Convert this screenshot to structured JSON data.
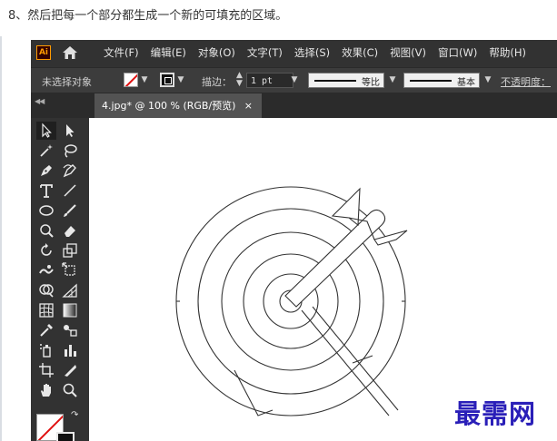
{
  "instruction": "8、然后把每一个部分都生成一个新的可填充的区域。",
  "app": {
    "logo_text": "Ai",
    "menu": [
      "文件(F)",
      "编辑(E)",
      "对象(O)",
      "文字(T)",
      "选择(S)",
      "效果(C)",
      "视图(V)",
      "窗口(W)",
      "帮助(H)"
    ]
  },
  "controlbar": {
    "selection_state": "未选择对象",
    "stroke_label": "描边：",
    "stroke_value": "1 pt",
    "profile_1": "等比",
    "profile_2": "基本",
    "opacity_label": "不透明度："
  },
  "document_tab": {
    "label": "4.jpg* @ 100 % (RGB/预览)",
    "close": "×"
  },
  "watermark": "最需网",
  "colors": {
    "app_bg": "#323232",
    "accent_logo": "#ff9a00",
    "watermark": "#2a1fb8"
  },
  "icons": [
    "home-icon",
    "selection-tool-icon",
    "direct-selection-tool-icon",
    "magic-wand-icon",
    "lasso-icon",
    "pen-tool-icon",
    "curvature-tool-icon",
    "type-tool-icon",
    "line-tool-icon",
    "ellipse-tool-icon",
    "paintbrush-icon",
    "shaper-tool-icon",
    "eraser-icon",
    "rotate-tool-icon",
    "scale-tool-icon",
    "warp-tool-icon",
    "free-transform-icon",
    "shape-builder-icon",
    "perspective-grid-icon",
    "mesh-tool-icon",
    "gradient-tool-icon",
    "eyedropper-icon",
    "blend-tool-icon",
    "symbol-sprayer-icon",
    "column-graph-icon",
    "artboard-tool-icon",
    "slice-tool-icon",
    "hand-tool-icon",
    "zoom-tool-icon"
  ]
}
